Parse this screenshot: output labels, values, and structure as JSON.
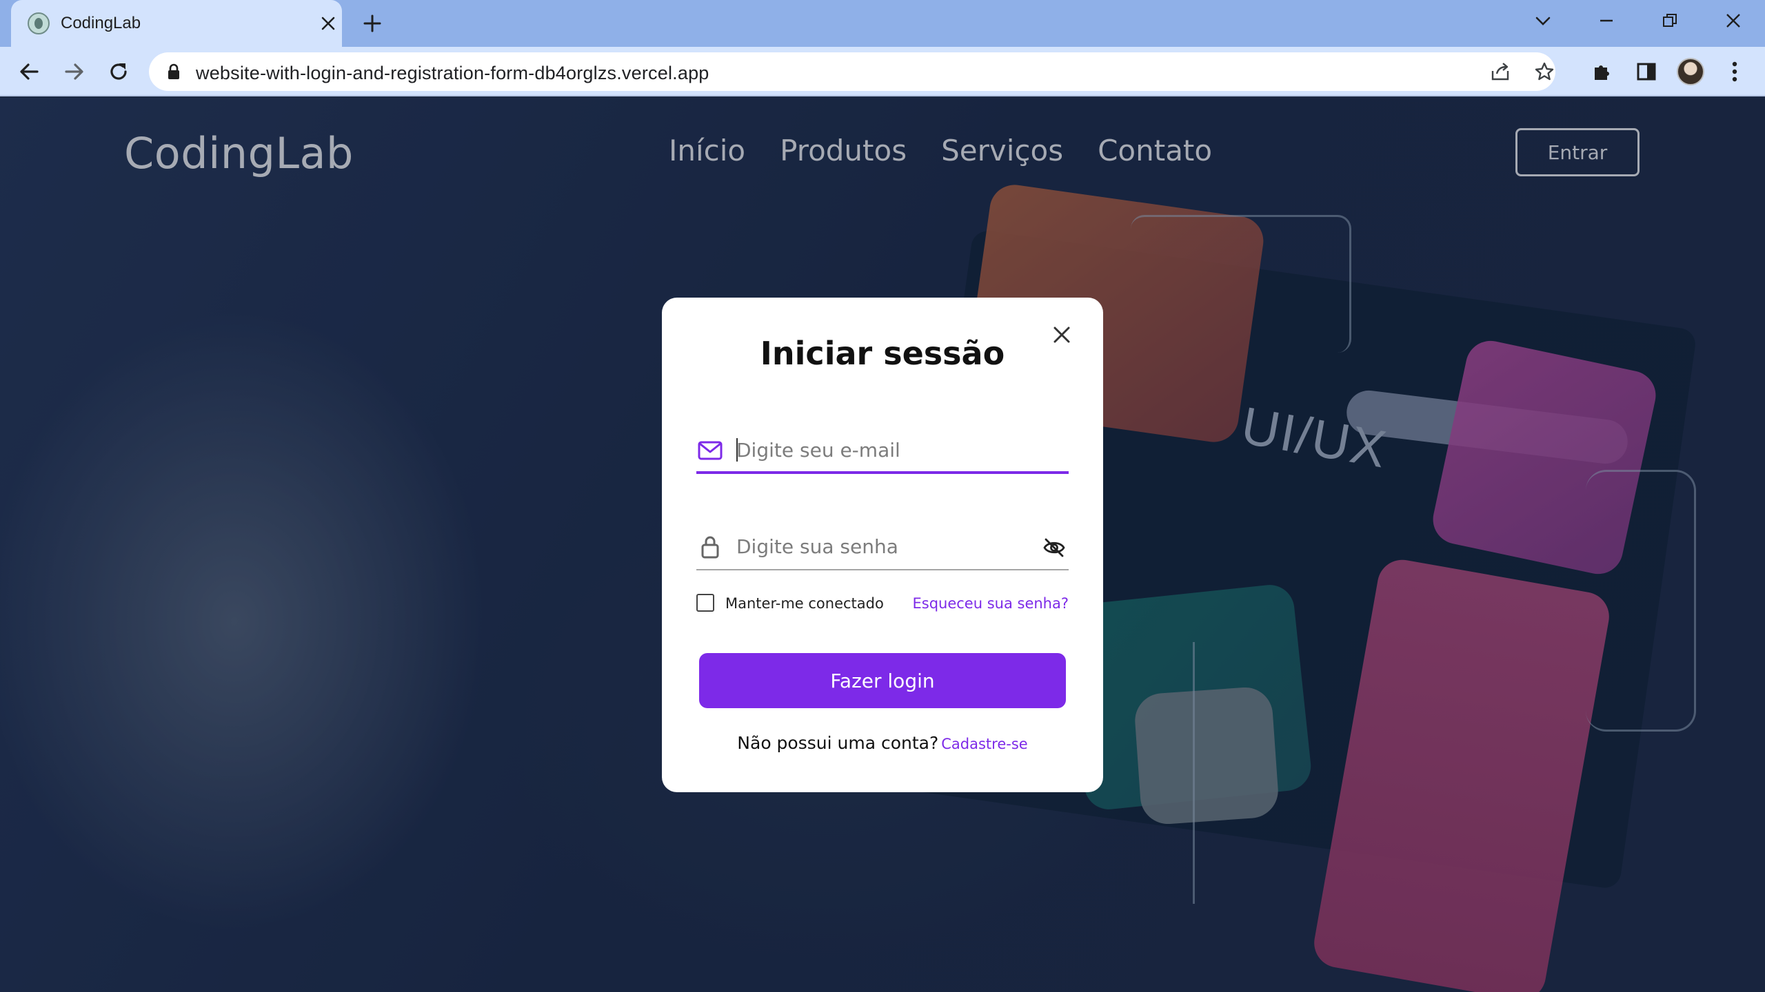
{
  "browser": {
    "tab_title": "CodingLab",
    "url": "website-with-login-and-registration-form-db4orglzs.vercel.app",
    "icons": {
      "favicon": "codinglab-favicon",
      "tab_close": "close-icon",
      "new_tab": "plus-icon",
      "tab_search": "chevron-down-icon",
      "minimize": "minimize-icon",
      "restore": "restore-icon",
      "window_close": "close-icon",
      "back": "arrow-left-icon",
      "forward": "arrow-right-icon",
      "reload": "reload-icon",
      "lock": "lock-icon",
      "share": "share-icon",
      "bookmark": "star-icon",
      "extensions": "puzzle-icon",
      "side_panel": "side-panel-icon",
      "profile": "avatar",
      "menu": "kebab-menu-icon"
    }
  },
  "site": {
    "brand": "CodingLab",
    "nav": [
      "Início",
      "Produtos",
      "Serviços",
      "Contato"
    ],
    "login_button": "Entrar",
    "hero_decoration_text": "UI/UX"
  },
  "modal": {
    "title": "Iniciar sessão",
    "email": {
      "placeholder": "Digite seu e-mail",
      "value": "",
      "focused": true,
      "icon": "mail-icon"
    },
    "password": {
      "placeholder": "Digite sua senha",
      "value": "",
      "icon": "lock-icon",
      "toggle_icon": "eye-off-icon"
    },
    "remember_label": "Manter-me conectado",
    "remember_checked": false,
    "forgot_link": "Esqueceu sua senha?",
    "submit_label": "Fazer login",
    "signup_prompt": "Não possui uma conta?",
    "signup_link": "Cadastre-se",
    "close_icon": "close-icon"
  },
  "colors": {
    "accent": "#7d2ae8",
    "tabstrip": "#8fb0e8",
    "toolbar": "#d3e3fd",
    "modal_bg": "#ffffff"
  }
}
